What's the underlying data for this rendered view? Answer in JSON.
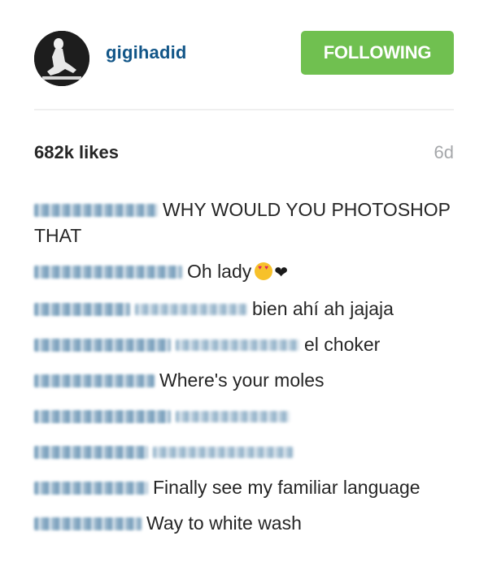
{
  "header": {
    "username": "gigihadid",
    "follow_label": "FOLLOWING",
    "accent_color": "#70c050",
    "username_color": "#125688",
    "avatar_icon": "profile-photo"
  },
  "stats": {
    "likes": "682k likes",
    "time": "6d"
  },
  "comments": [
    {
      "username_blurred": true,
      "text": "WHY WOULD YOU PHOTOSHOP THAT"
    },
    {
      "username_blurred": true,
      "text": "Oh lady",
      "emoji": [
        "heart-eyes-emoji",
        "black-heart-emoji"
      ]
    },
    {
      "username_blurred": true,
      "mention_blurred": true,
      "text": "bien ahí ah jajaja"
    },
    {
      "username_blurred": true,
      "mention_blurred": true,
      "text": "el choker"
    },
    {
      "username_blurred": true,
      "text": "Where's your moles"
    },
    {
      "username_blurred": true,
      "mention_blurred": true,
      "text": ""
    },
    {
      "username_blurred": true,
      "mention_blurred": true,
      "text": ""
    },
    {
      "username_blurred": true,
      "text": "Finally see my familiar language"
    },
    {
      "username_blurred": true,
      "text": "Way to white wash"
    }
  ]
}
